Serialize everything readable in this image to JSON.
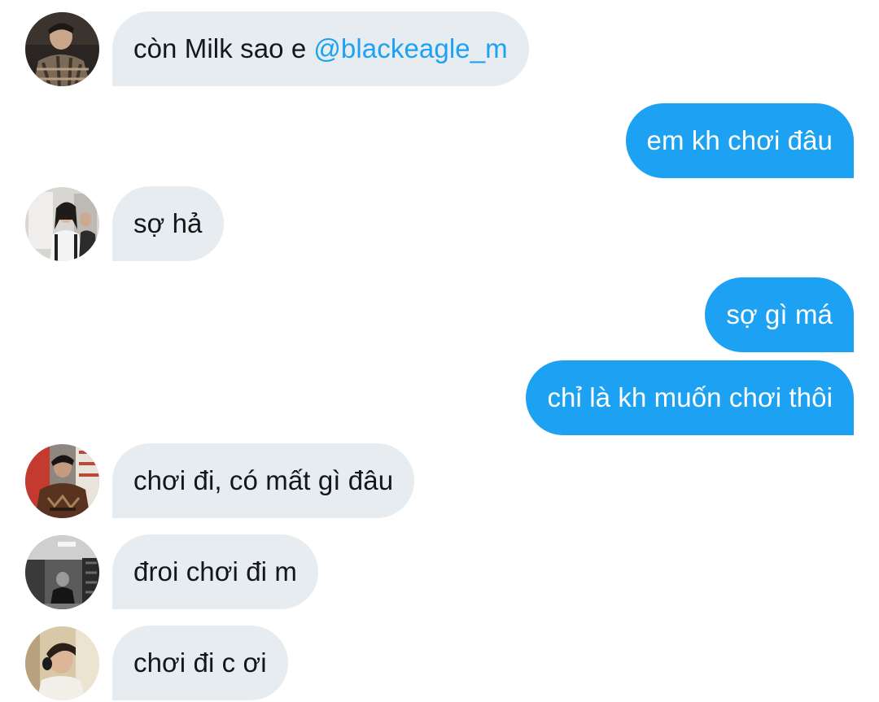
{
  "messages": [
    {
      "side": "in",
      "avatar": "avatar-man-plaid-shirt",
      "text": "còn Milk sao e",
      "mention": "@blackeagle_m"
    },
    {
      "side": "out",
      "text": "em kh chơi đâu"
    },
    {
      "side": "in",
      "avatar": "avatar-mirror-selfie",
      "text": "sợ hả"
    },
    {
      "side": "out",
      "text": "sợ gì má"
    },
    {
      "side": "out",
      "text": "chỉ là kh muốn chơi thôi"
    },
    {
      "side": "in",
      "avatar": "avatar-man-brown-jacket",
      "text": "chơi đi, có mất gì đâu"
    },
    {
      "side": "in",
      "avatar": "avatar-street-monochrome",
      "text": "đroi chơi đi m"
    },
    {
      "side": "in",
      "avatar": "avatar-boy-headphones",
      "text": "chơi đi c ơi"
    }
  ],
  "colors": {
    "incoming_bubble": "#e6ecf0",
    "outgoing_bubble": "#1da1f2",
    "incoming_text": "#14171a",
    "mention": "#1da1f2"
  }
}
